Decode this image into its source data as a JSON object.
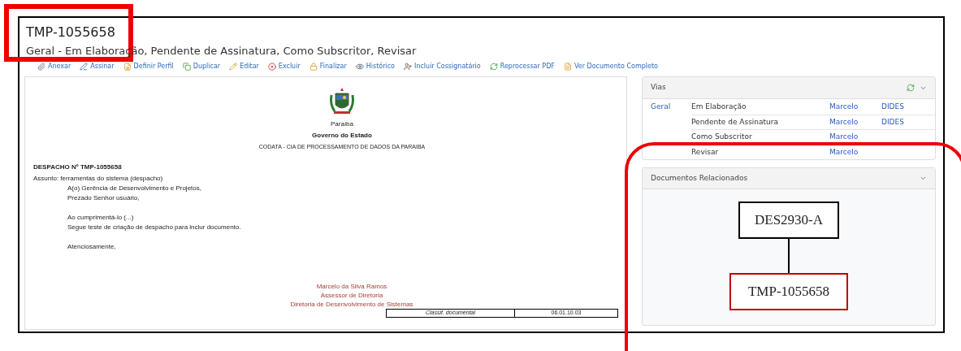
{
  "header": {
    "title": "TMP-1055658",
    "subtitle": "Geral - Em Elaboração, Pendente de Assinatura, Como Subscritor, Revisar"
  },
  "toolbar": [
    {
      "label": "Anexar",
      "kind": "attach"
    },
    {
      "label": "Assinar",
      "kind": "sign"
    },
    {
      "label": "Definir Perfil",
      "kind": "profile"
    },
    {
      "label": "Duplicar",
      "kind": "duplicate"
    },
    {
      "label": "Editar",
      "kind": "edit"
    },
    {
      "label": "Excluir",
      "kind": "delete"
    },
    {
      "label": "Finalizar",
      "kind": "finish"
    },
    {
      "label": "Histórico",
      "kind": "history"
    },
    {
      "label": "Incluir Cossignatário",
      "kind": "cosigner"
    },
    {
      "label": "Reprocessar PDF",
      "kind": "reprocess"
    },
    {
      "label": "Ver Documento Completo",
      "kind": "view"
    }
  ],
  "document": {
    "state": "Paraíba",
    "government": "Governo do Estado",
    "agency": "CODATA - CIA DE PROCESSAMENTO DE DADOS DA PARAIBA",
    "number": "DESPACHO Nº TMP-1055658",
    "subject": "Assunto: ferramentas do sistema (despacho)",
    "body": [
      [
        "A(o) Gerência de Desenvolvimento e Projetos,",
        "Prezado Senhor usuário,"
      ],
      [
        "Ao cumprimentá-lo (...)",
        "Segue teste de criação de despacho para inclur documento."
      ],
      [
        "Atenciosamente,"
      ]
    ],
    "signature": [
      "Marcelo da Silva Ramos",
      "Assessor de Diretoria",
      "Diretoria de Desenvolvimento de Sistemas"
    ],
    "classification": {
      "label": "Classif. documental",
      "value": "06.01.10.03"
    }
  },
  "vias": {
    "title": "Vias",
    "rows": [
      {
        "via": "Geral",
        "state": "Em Elaboração",
        "person": "Marcelo",
        "unit": "DIDES"
      },
      {
        "state": "Pendente de Assinatura",
        "person": "Marcelo",
        "unit": "DIDES"
      },
      {
        "state": "Como Subscritor",
        "person": "Marcelo"
      },
      {
        "state": "Revisar",
        "person": "Marcelo"
      }
    ]
  },
  "related": {
    "title": "Documentos Relacionados",
    "nodes": [
      {
        "label": "DES2930-A",
        "current": false
      },
      {
        "label": "TMP-1055658",
        "current": true
      }
    ]
  }
}
